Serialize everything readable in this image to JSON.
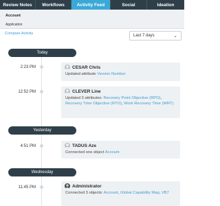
{
  "tabs": [
    {
      "label": "Review Notes",
      "active": false
    },
    {
      "label": "Workflows",
      "active": false
    },
    {
      "label": "Activity Feed",
      "active": true
    },
    {
      "label": "Social",
      "active": false
    },
    {
      "label": "Ideation",
      "active": false
    }
  ],
  "filters": {
    "account_label": "Account",
    "application_label": "Application"
  },
  "compare_link": "Compare Activity",
  "range_select": {
    "value": "Last 7 days"
  },
  "days": {
    "today": "Today",
    "yesterday": "Yesterday",
    "wednesday": "Wednesday"
  },
  "activities": [
    {
      "time": "2:23 PM",
      "user": "CESAR Chris",
      "text": "Updated attribute",
      "links": [
        "Version Number"
      ]
    },
    {
      "time": "12:52 PM",
      "user": "CLEVER Line",
      "text": "Updated 3 attributes:",
      "links": [
        "Recovery Point Objective (RPO)",
        "Recovery Time Objective (RTO)",
        "Work Recovery Time (WRT)"
      ]
    },
    {
      "time": "4:51 PM",
      "user": "TADUS Aze",
      "text": "Connected one object",
      "links": [
        "Account"
      ]
    },
    {
      "time": "11:45 PM",
      "user": "Administrator",
      "text": "Connected 3 objects:",
      "links": [
        "Account",
        "Global Capability Map",
        "VB7"
      ]
    }
  ],
  "colors": {
    "tab_bar": "#2f3f4a",
    "tab_active": "#3aa9d8",
    "link": "#3a9bd5",
    "card_bg": "#eef1f3"
  },
  "icons": {
    "avatar": "user-avatar-icon",
    "select": "chevron-down-icon"
  }
}
